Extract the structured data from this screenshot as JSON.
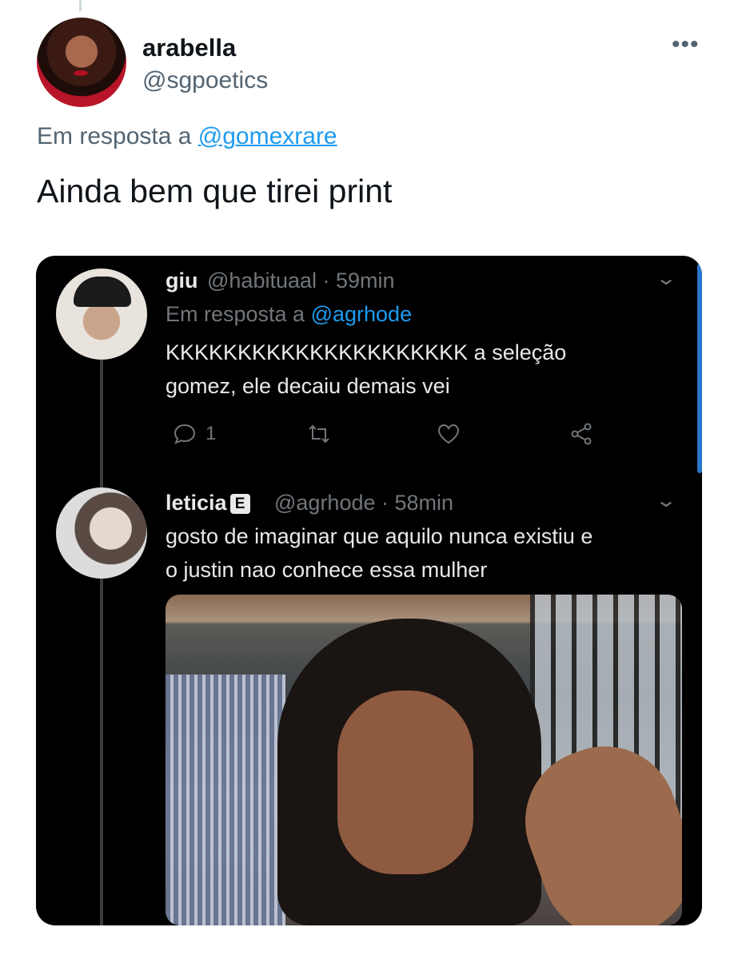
{
  "header": {
    "display_name": "arabella",
    "handle": "@sgpoetics",
    "more_label": "•••"
  },
  "reply_to": {
    "prefix": "Em resposta a",
    "handle": "@gomexrare"
  },
  "tweet_text": "Ainda bem que tirei print",
  "screenshot": {
    "tweet1": {
      "name": "giu",
      "handle": "@habituaal",
      "time": "· 59min",
      "reply_prefix": "Em resposta a",
      "reply_handle": "@agrhode",
      "text_line1": "KKKKKKKKKKKKKKKKKKKKK a seleção",
      "text_line2": "gomez, ele decaiu demais vei",
      "reply_count": "1"
    },
    "tweet2": {
      "name": "leticia",
      "badge": "E",
      "handle": "@agrhode",
      "time": "· 58min",
      "text_line1": "gosto de imaginar que aquilo nunca existiu e",
      "text_line2": "o justin nao conhece essa mulher"
    }
  },
  "colors": {
    "accent": "#1d9bf0",
    "dark_bg": "#000000",
    "muted": "#536471"
  }
}
